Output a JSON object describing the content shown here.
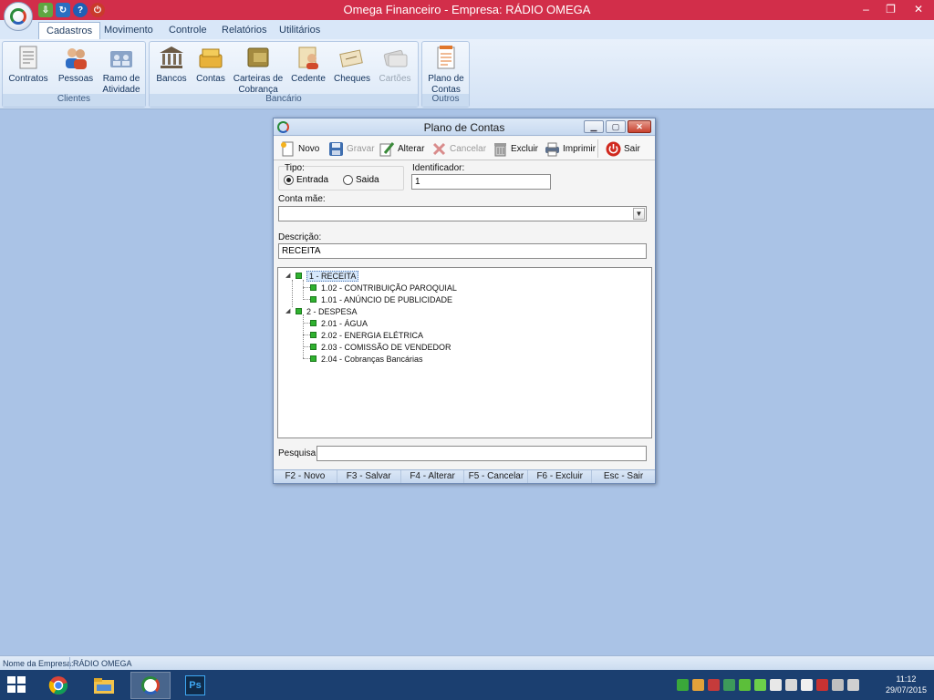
{
  "window": {
    "title": "Omega Financeiro - Empresa: RÁDIO OMEGA",
    "minimize": "‒",
    "restore": "❐",
    "close": "✕"
  },
  "ribbon": {
    "tabs": [
      "Cadastros",
      "Movimento",
      "Controle",
      "Relatórios",
      "Utilitários"
    ],
    "groups": {
      "clientes": {
        "label": "Clientes",
        "buttons": [
          {
            "label": "Contratos",
            "icon": "contracts-icon"
          },
          {
            "label": "Pessoas",
            "icon": "people-icon"
          },
          {
            "label": "Ramo de Atividade",
            "icon": "business-icon"
          }
        ]
      },
      "bancario": {
        "label": "Bancário",
        "buttons": [
          {
            "label": "Bancos",
            "icon": "bank-icon"
          },
          {
            "label": "Contas",
            "icon": "accounts-icon"
          },
          {
            "label": "Carteiras de Cobrança",
            "icon": "wallet-icon"
          },
          {
            "label": "Cedente",
            "icon": "assignor-icon"
          },
          {
            "label": "Cheques",
            "icon": "checks-icon"
          },
          {
            "label": "Cartões",
            "icon": "cards-icon"
          }
        ]
      },
      "outros": {
        "label": "Outros",
        "buttons": [
          {
            "label": "Plano de Contas",
            "icon": "chart-of-accounts-icon"
          }
        ]
      }
    }
  },
  "dialog": {
    "title": "Plano de Contas",
    "toolbar": {
      "novo": "Novo",
      "gravar": "Gravar",
      "alterar": "Alterar",
      "cancelar": "Cancelar",
      "excluir": "Excluir",
      "imprimir": "Imprimir",
      "sair": "Sair"
    },
    "tipo": {
      "label": "Tipo:",
      "entrada": "Entrada",
      "saida": "Saida",
      "selected": "Entrada"
    },
    "identificador": {
      "label": "Identificador:",
      "value": "1"
    },
    "conta_mae": {
      "label": "Conta mãe:",
      "value": ""
    },
    "descricao": {
      "label": "Descrição:",
      "value": "RECEITA"
    },
    "tree": [
      {
        "label": "1 - RECEITA",
        "selected": true,
        "children": [
          {
            "label": "1.02 - CONTRIBUIÇÃO PAROQUIAL"
          },
          {
            "label": "1.01 - ANÚNCIO DE PUBLICIDADE"
          }
        ]
      },
      {
        "label": "2 - DESPESA",
        "children": [
          {
            "label": "2.01 - ÁGUA"
          },
          {
            "label": "2.02 - ENERGIA ELÉTRICA"
          },
          {
            "label": "2.03 - COMISSÃO DE VENDEDOR"
          },
          {
            "label": "2.04 - Cobranças Bancárias"
          }
        ]
      }
    ],
    "pesquisa": {
      "label": "Pesquisa:",
      "value": ""
    },
    "shortcuts": [
      "F2 - Novo",
      "F3 - Salvar",
      "F4 - Alterar",
      "F5 - Cancelar",
      "F6 - Excluir",
      "Esc - Sair"
    ]
  },
  "statusbar": {
    "label": "Nome da Empresa:",
    "value": "RÁDIO OMEGA"
  },
  "taskbar": {
    "apps": [
      "chrome-icon",
      "file-explorer-icon",
      "omega-financeiro-icon",
      "photoshop-icon"
    ],
    "photoshop_label": "Ps",
    "time": "11:12",
    "date": "29/07/2015"
  },
  "colors": {
    "titlebar": "#d22e4a",
    "desktop": "#aac3e6",
    "taskbar": "#1b3f70",
    "tree_node": "#2fb12f"
  }
}
